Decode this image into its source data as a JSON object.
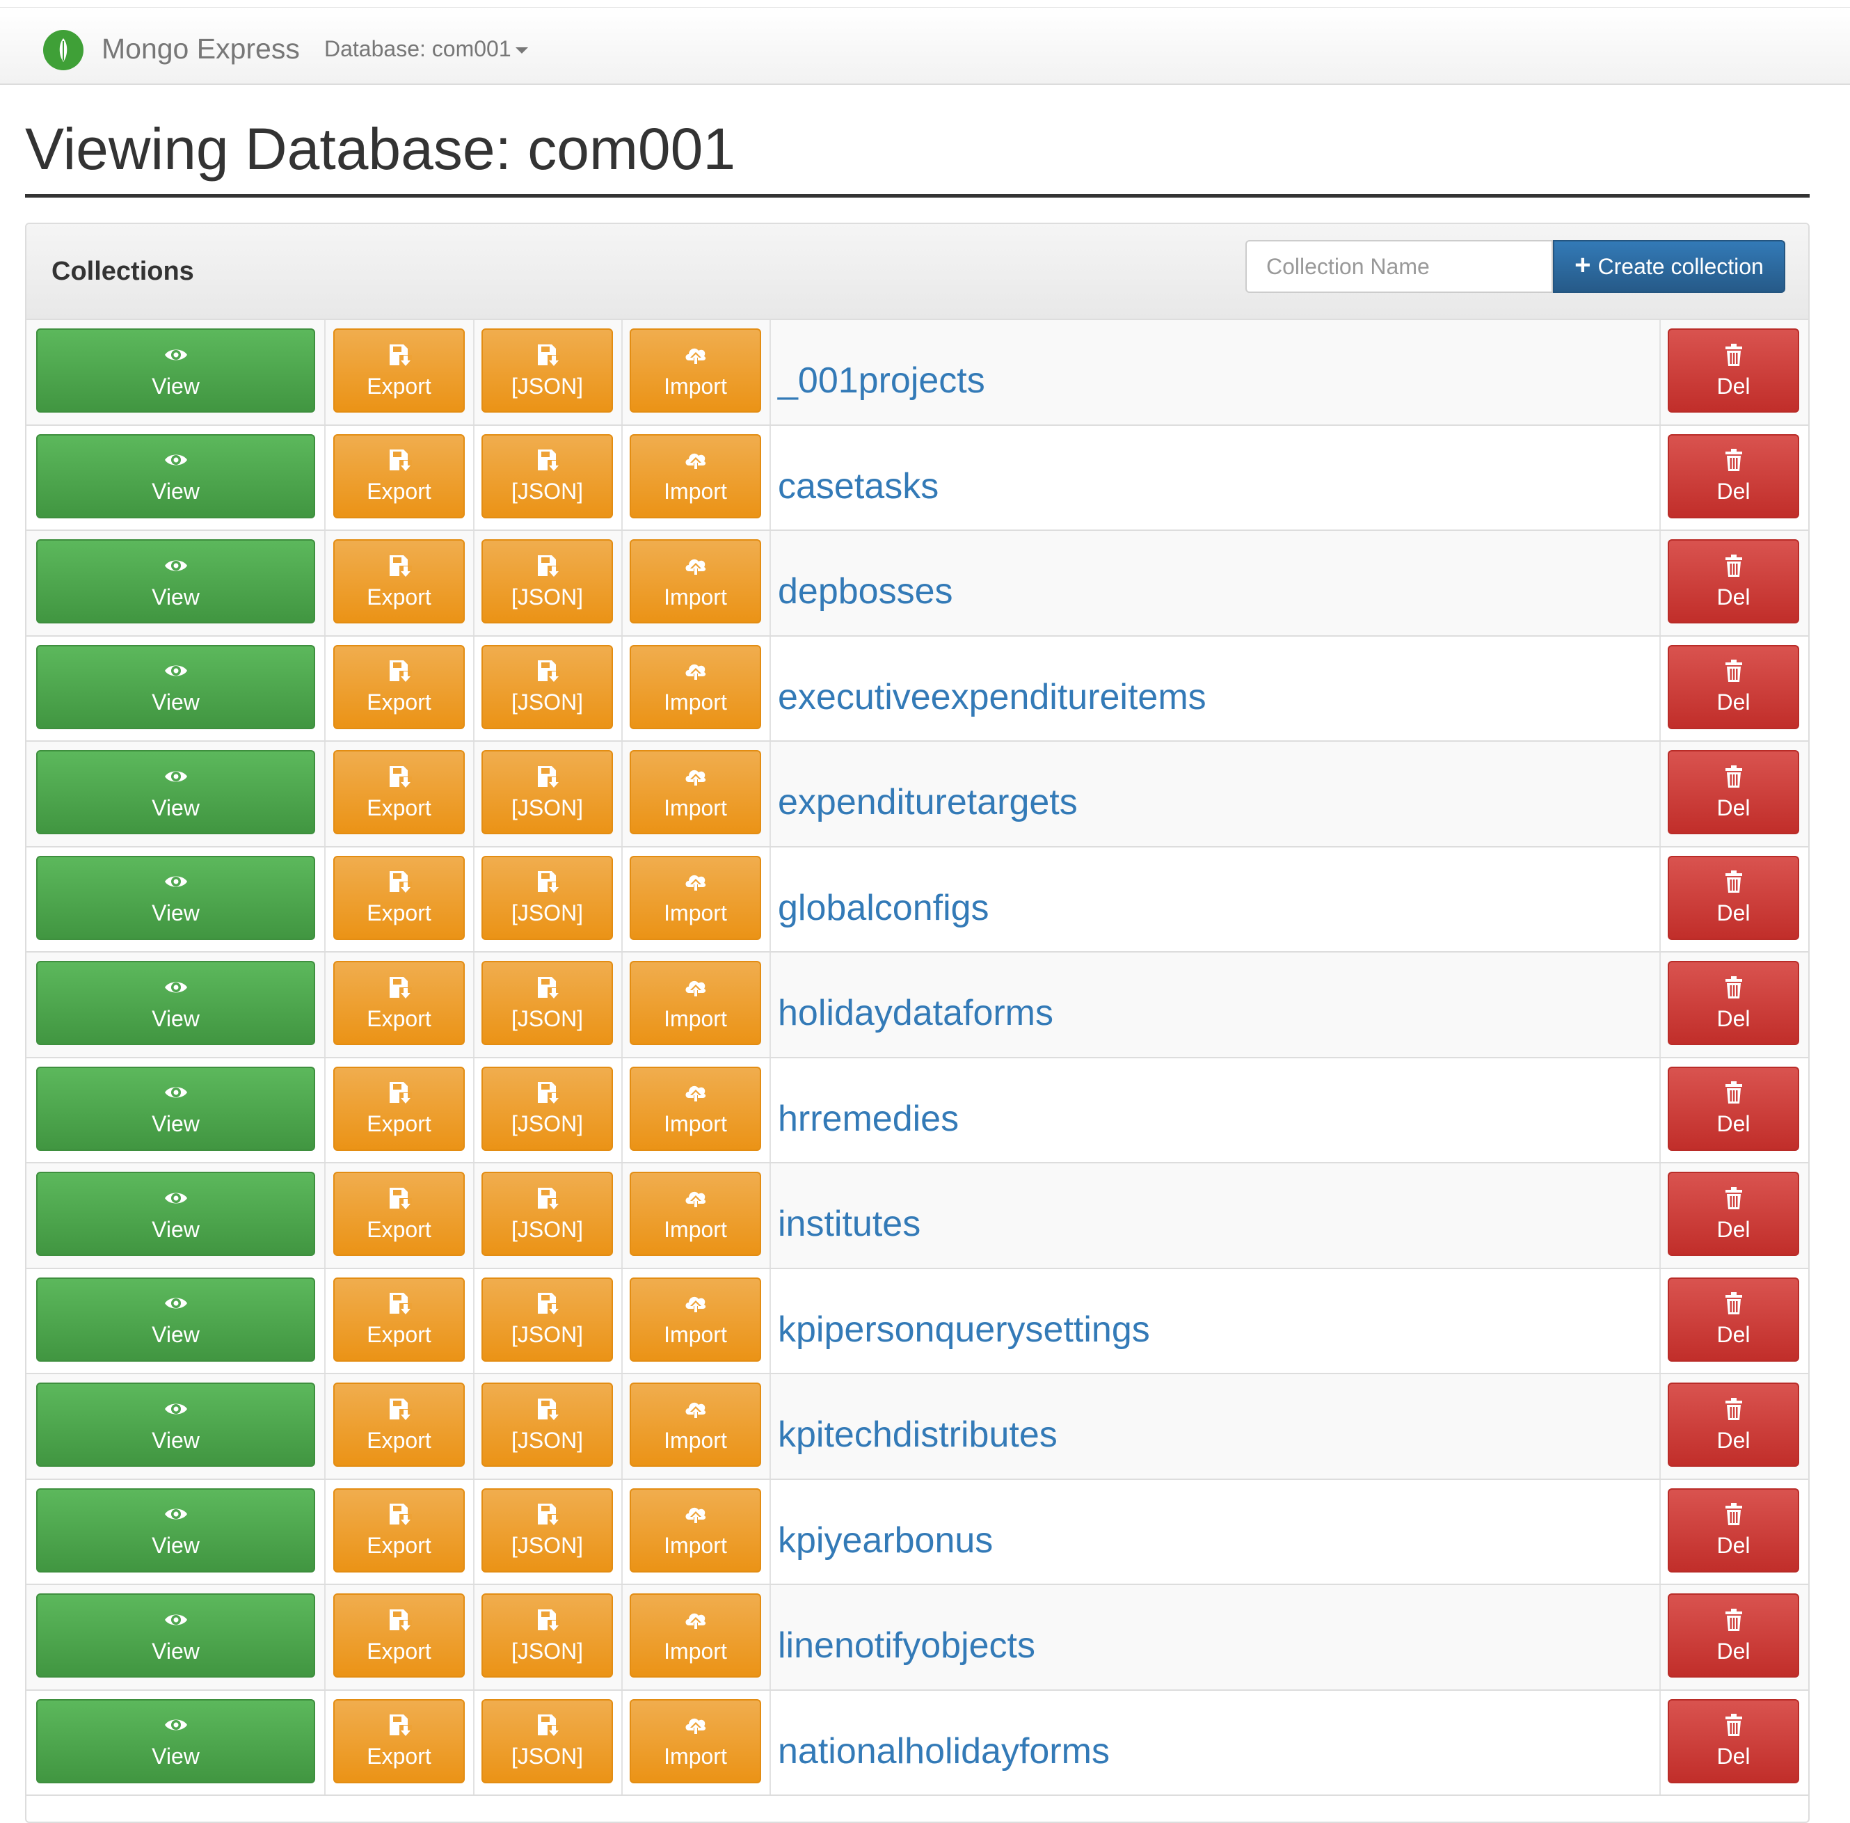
{
  "navbar": {
    "brand": "Mongo Express",
    "database_label": "Database: com001"
  },
  "page": {
    "title": "Viewing Database: com001"
  },
  "panel": {
    "title": "Collections",
    "collection_input_placeholder": "Collection Name",
    "create_button_label": "Create collection"
  },
  "row_buttons": {
    "view": "View",
    "export": "Export",
    "json": "[JSON]",
    "import": "Import",
    "del": "Del"
  },
  "collections": [
    "_001projects",
    "casetasks",
    "depbosses",
    "executiveexpenditureitems",
    "expendituretargets",
    "globalconfigs",
    "holidaydataforms",
    "hrremedies",
    "institutes",
    "kpipersonquerysettings",
    "kpitechdistributes",
    "kpiyearbonus",
    "linenotifyobjects",
    "nationalholidayforms"
  ],
  "colors": {
    "view": "#5cb85c",
    "export": "#f0ad4e",
    "del": "#d9534f",
    "create": "#337ab7",
    "link": "#337ab7",
    "logo": "#3fa037"
  }
}
